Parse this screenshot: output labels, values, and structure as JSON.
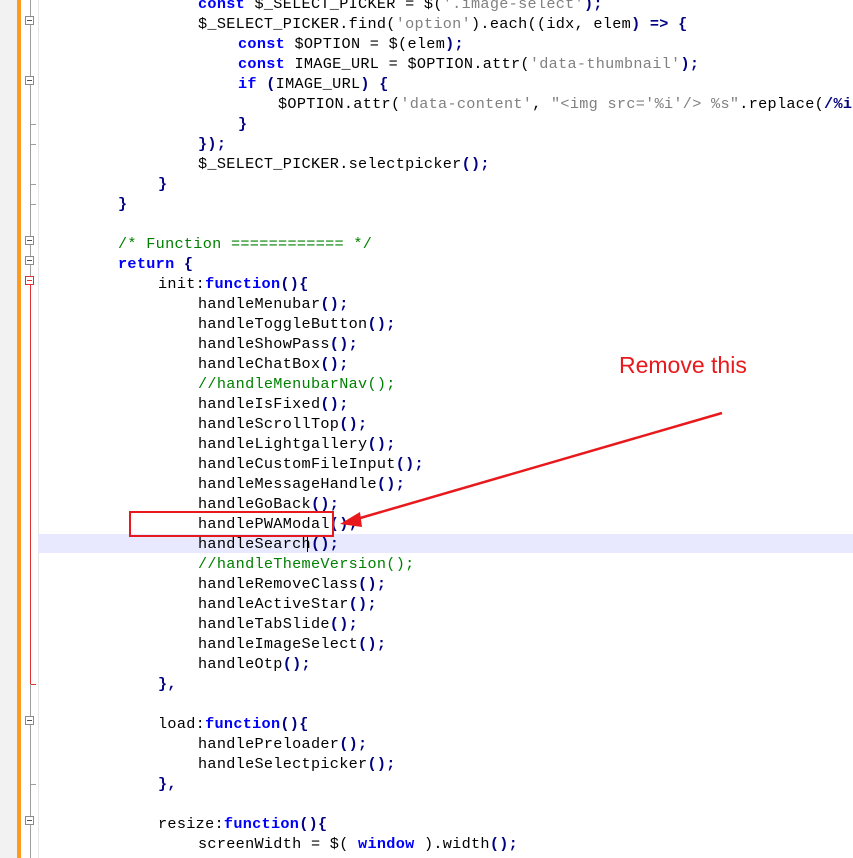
{
  "editor": {
    "lines": [
      {
        "indent": 4,
        "tokens": [
          {
            "t": "kw",
            "v": "const "
          },
          {
            "t": "fn",
            "v": "$_SELECT_PICKER = $("
          },
          {
            "t": "str",
            "v": "'.image-select'"
          },
          {
            "t": "op",
            "v": ");"
          }
        ]
      },
      {
        "indent": 4,
        "tokens": [
          {
            "t": "fn",
            "v": "$_SELECT_PICKER.find("
          },
          {
            "t": "str",
            "v": "'option'"
          },
          {
            "t": "fn",
            "v": ").each(("
          },
          {
            "t": "fn",
            "v": "idx, elem"
          },
          {
            "t": "op",
            "v": ") => {"
          }
        ]
      },
      {
        "indent": 5,
        "tokens": [
          {
            "t": "kw",
            "v": "const "
          },
          {
            "t": "fn",
            "v": "$OPTION = $(elem"
          },
          {
            "t": "op",
            "v": ");"
          }
        ]
      },
      {
        "indent": 5,
        "tokens": [
          {
            "t": "kw",
            "v": "const "
          },
          {
            "t": "fn",
            "v": "IMAGE_URL = $OPTION.attr("
          },
          {
            "t": "str",
            "v": "'data-thumbnail'"
          },
          {
            "t": "op",
            "v": ");"
          }
        ]
      },
      {
        "indent": 5,
        "tokens": [
          {
            "t": "kw",
            "v": "if "
          },
          {
            "t": "op",
            "v": "("
          },
          {
            "t": "fn",
            "v": "IMAGE_URL"
          },
          {
            "t": "op",
            "v": ") {"
          }
        ]
      },
      {
        "indent": 6,
        "tokens": [
          {
            "t": "fn",
            "v": "$OPTION.attr("
          },
          {
            "t": "str",
            "v": "'data-content'"
          },
          {
            "t": "fn",
            "v": ", "
          },
          {
            "t": "str",
            "v": "\"<img src='%i'/> %s\""
          },
          {
            "t": "fn",
            "v": ".replace("
          },
          {
            "t": "op",
            "v": "/%i/"
          }
        ]
      },
      {
        "indent": 5,
        "tokens": [
          {
            "t": "op",
            "v": "}"
          }
        ]
      },
      {
        "indent": 4,
        "tokens": [
          {
            "t": "op",
            "v": "});"
          }
        ]
      },
      {
        "indent": 4,
        "tokens": [
          {
            "t": "fn",
            "v": "$_SELECT_PICKER.selectpicker"
          },
          {
            "t": "op",
            "v": "();"
          }
        ]
      },
      {
        "indent": 3,
        "tokens": [
          {
            "t": "op",
            "v": "}"
          }
        ]
      },
      {
        "indent": 2,
        "tokens": [
          {
            "t": "op",
            "v": "}"
          }
        ]
      },
      {
        "indent": 0,
        "tokens": []
      },
      {
        "indent": 2,
        "tokens": [
          {
            "t": "cm",
            "v": "/* Function ============ */"
          }
        ]
      },
      {
        "indent": 2,
        "tokens": [
          {
            "t": "kw",
            "v": "return "
          },
          {
            "t": "op",
            "v": "{"
          }
        ]
      },
      {
        "indent": 3,
        "tokens": [
          {
            "t": "fn",
            "v": "init:"
          },
          {
            "t": "kw",
            "v": "function"
          },
          {
            "t": "op",
            "v": "(){"
          }
        ]
      },
      {
        "indent": 4,
        "tokens": [
          {
            "t": "fn",
            "v": "handleMenubar"
          },
          {
            "t": "op",
            "v": "();"
          }
        ]
      },
      {
        "indent": 4,
        "tokens": [
          {
            "t": "fn",
            "v": "handleToggleButton"
          },
          {
            "t": "op",
            "v": "();"
          }
        ]
      },
      {
        "indent": 4,
        "tokens": [
          {
            "t": "fn",
            "v": "handleShowPass"
          },
          {
            "t": "op",
            "v": "();"
          }
        ]
      },
      {
        "indent": 4,
        "tokens": [
          {
            "t": "fn",
            "v": "handleChatBox"
          },
          {
            "t": "op",
            "v": "();"
          }
        ]
      },
      {
        "indent": 4,
        "tokens": [
          {
            "t": "cm",
            "v": "//handleMenubarNav();"
          }
        ]
      },
      {
        "indent": 4,
        "tokens": [
          {
            "t": "fn",
            "v": "handleIsFixed"
          },
          {
            "t": "op",
            "v": "();"
          }
        ]
      },
      {
        "indent": 4,
        "tokens": [
          {
            "t": "fn",
            "v": "handleScrollTop"
          },
          {
            "t": "op",
            "v": "();"
          }
        ]
      },
      {
        "indent": 4,
        "tokens": [
          {
            "t": "fn",
            "v": "handleLightgallery"
          },
          {
            "t": "op",
            "v": "();"
          }
        ]
      },
      {
        "indent": 4,
        "tokens": [
          {
            "t": "fn",
            "v": "handleCustomFileInput"
          },
          {
            "t": "op",
            "v": "();"
          }
        ]
      },
      {
        "indent": 4,
        "tokens": [
          {
            "t": "fn",
            "v": "handleMessageHandle"
          },
          {
            "t": "op",
            "v": "();"
          }
        ]
      },
      {
        "indent": 4,
        "tokens": [
          {
            "t": "fn",
            "v": "handleGoBack"
          },
          {
            "t": "op",
            "v": "();"
          }
        ]
      },
      {
        "indent": 4,
        "tokens": [
          {
            "t": "fn",
            "v": "handlePWAModal"
          },
          {
            "t": "op",
            "v": "();"
          }
        ]
      },
      {
        "indent": 4,
        "tokens": [
          {
            "t": "fn",
            "v": "handleSearch"
          },
          {
            "t": "op",
            "v": "();"
          }
        ]
      },
      {
        "indent": 4,
        "tokens": [
          {
            "t": "cm",
            "v": "//handleThemeVersion();"
          }
        ]
      },
      {
        "indent": 4,
        "tokens": [
          {
            "t": "fn",
            "v": "handleRemoveClass"
          },
          {
            "t": "op",
            "v": "();"
          }
        ]
      },
      {
        "indent": 4,
        "tokens": [
          {
            "t": "fn",
            "v": "handleActiveStar"
          },
          {
            "t": "op",
            "v": "();"
          }
        ]
      },
      {
        "indent": 4,
        "tokens": [
          {
            "t": "fn",
            "v": "handleTabSlide"
          },
          {
            "t": "op",
            "v": "();"
          }
        ]
      },
      {
        "indent": 4,
        "tokens": [
          {
            "t": "fn",
            "v": "handleImageSelect"
          },
          {
            "t": "op",
            "v": "();"
          }
        ]
      },
      {
        "indent": 4,
        "tokens": [
          {
            "t": "fn",
            "v": "handleOtp"
          },
          {
            "t": "op",
            "v": "();"
          }
        ]
      },
      {
        "indent": 3,
        "tokens": [
          {
            "t": "op",
            "v": "},"
          }
        ]
      },
      {
        "indent": 0,
        "tokens": []
      },
      {
        "indent": 3,
        "tokens": [
          {
            "t": "fn",
            "v": "load:"
          },
          {
            "t": "kw",
            "v": "function"
          },
          {
            "t": "op",
            "v": "(){"
          }
        ]
      },
      {
        "indent": 4,
        "tokens": [
          {
            "t": "fn",
            "v": "handlePreloader"
          },
          {
            "t": "op",
            "v": "();"
          }
        ]
      },
      {
        "indent": 4,
        "tokens": [
          {
            "t": "fn",
            "v": "handleSelectpicker"
          },
          {
            "t": "op",
            "v": "();"
          }
        ]
      },
      {
        "indent": 3,
        "tokens": [
          {
            "t": "op",
            "v": "},"
          }
        ]
      },
      {
        "indent": 0,
        "tokens": []
      },
      {
        "indent": 3,
        "tokens": [
          {
            "t": "fn",
            "v": "resize:"
          },
          {
            "t": "kw",
            "v": "function"
          },
          {
            "t": "op",
            "v": "(){"
          }
        ]
      },
      {
        "indent": 4,
        "tokens": [
          {
            "t": "fn",
            "v": "screenWidth = $( "
          },
          {
            "t": "kw",
            "v": "window"
          },
          {
            "t": "fn",
            "v": " ).width"
          },
          {
            "t": "op",
            "v": "();"
          }
        ]
      }
    ]
  },
  "annotation": {
    "label": "Remove this",
    "color": "#e8191c",
    "target_line": "handlePWAModal();"
  },
  "colors": {
    "change_bar": "#ff9a1f",
    "current_line": "#e8e8ff",
    "keyword": "#0000ff",
    "string": "#808080",
    "comment": "#008000"
  }
}
